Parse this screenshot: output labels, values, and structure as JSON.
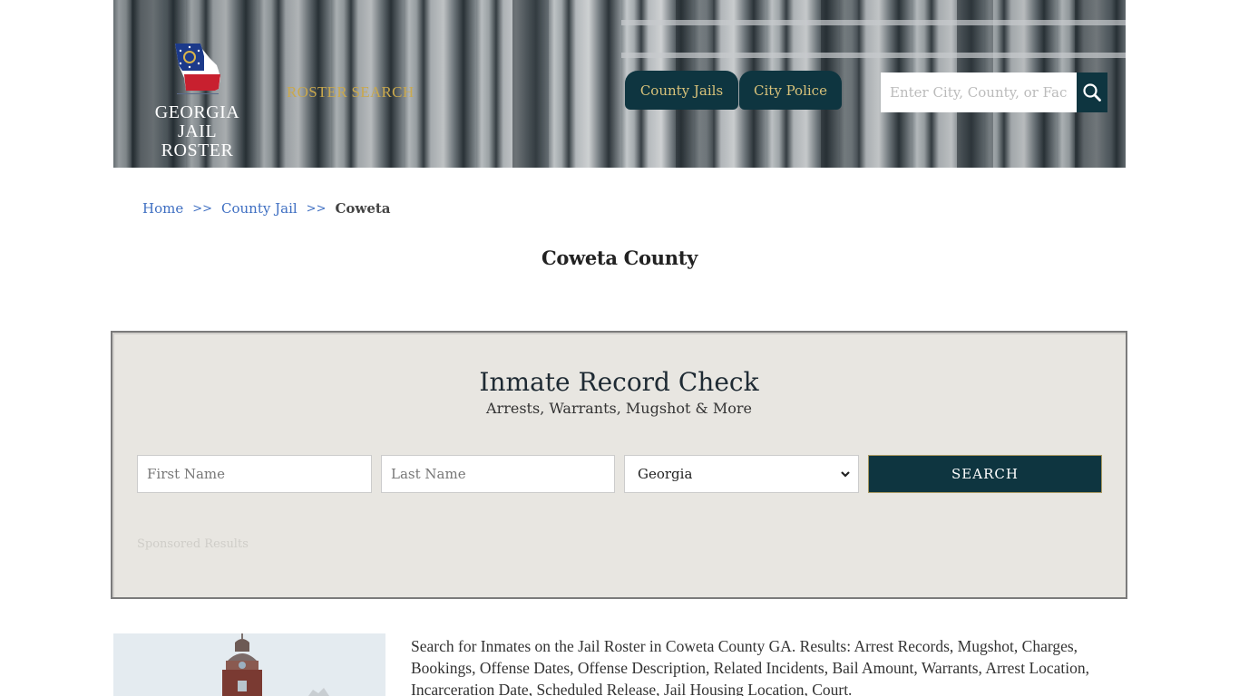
{
  "header": {
    "logo_line1": "GEORGIA",
    "logo_line2": "JAIL ROSTER",
    "roster_search_link": "ROSTER SEARCH",
    "nav": [
      {
        "label": "County Jails"
      },
      {
        "label": "City Police"
      }
    ],
    "search": {
      "placeholder": "Enter City, County, or Facility",
      "value": "",
      "icon": "search-icon"
    },
    "colors": {
      "nav_bg": "#0e3540",
      "nav_text": "#d8c27a",
      "roster_search_text": "#c9a84d"
    }
  },
  "breadcrumb": {
    "items": [
      {
        "label": "Home"
      },
      {
        "label": "County Jail"
      },
      {
        "label": "Coweta"
      }
    ],
    "separator": ">>"
  },
  "page_title": "Coweta County",
  "record_check": {
    "title": "Inmate Record Check",
    "subtitle": "Arrests, Warrants, Mugshot & More",
    "first_name_placeholder": "First Name",
    "last_name_placeholder": "Last Name",
    "state_selected": "Georgia",
    "search_button": "SEARCH",
    "sponsored_label": "Sponsored Results"
  },
  "content": {
    "description": "Search for Inmates on the Jail Roster in Coweta County GA. Results: Arrest Records, Mugshot, Charges, Bookings, Offense Dates, Offense Description, Related Incidents, Bail Amount, Warrants, Arrest Location, Incarceration Date, Scheduled Release, Jail Housing Location, Court.",
    "image_alt": "Coweta County courthouse"
  }
}
